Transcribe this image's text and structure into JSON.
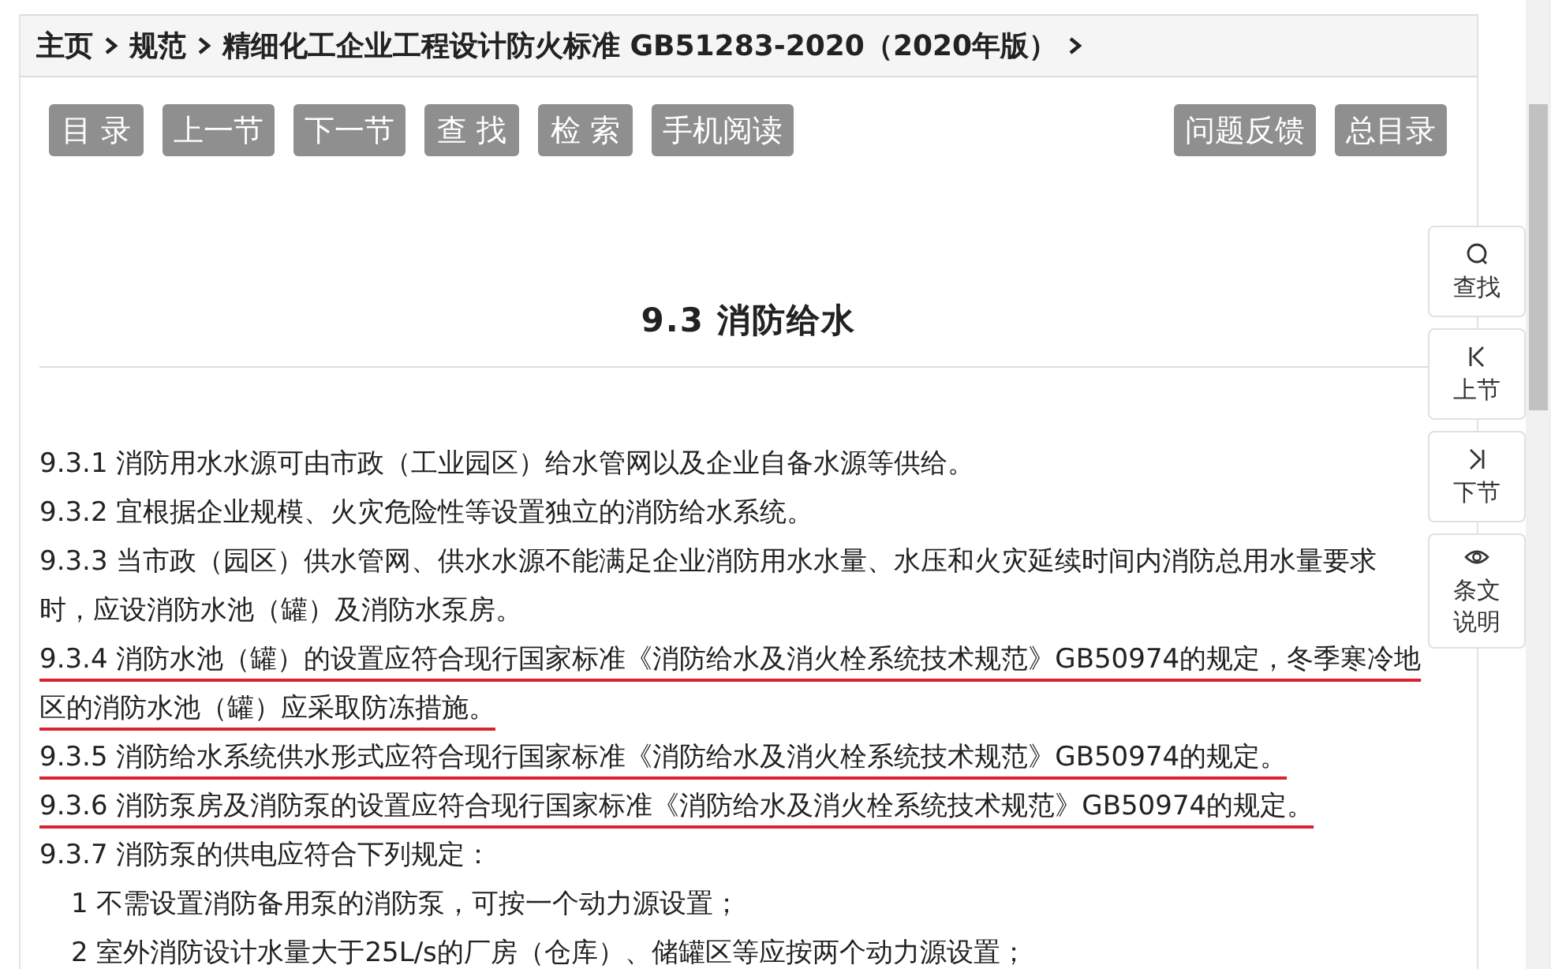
{
  "breadcrumb": [
    {
      "label": "主页"
    },
    {
      "label": "规范"
    },
    {
      "label": "精细化工企业工程设计防火标准 GB51283-2020（2020年版）"
    }
  ],
  "toolbar": {
    "left": [
      "目 录",
      "上一节",
      "下一节",
      "查 找",
      "检 索",
      "手机阅读"
    ],
    "right": [
      "问题反馈",
      "总目录"
    ]
  },
  "section_title": "9.3 消防给水",
  "paragraphs": [
    {
      "kind": "clause",
      "text": "9.3.1 消防用水水源可由市政（工业园区）给水管网以及企业自备水源等供给。",
      "underlined": false
    },
    {
      "kind": "clause",
      "text": "9.3.2 宜根据企业规模、火灾危险性等设置独立的消防给水系统。",
      "underlined": false
    },
    {
      "kind": "clause",
      "text": "9.3.3 当市政（园区）供水管网、供水水源不能满足企业消防用水水量、水压和火灾延续时间内消防总用水量要求时，应设消防水池（罐）及消防水泵房。",
      "underlined": false
    },
    {
      "kind": "clause",
      "text": "9.3.4 消防水池（罐）的设置应符合现行国家标准《消防给水及消火栓系统技术规范》GB50974的规定，冬季寒冷地区的消防水池（罐）应采取防冻措施。",
      "underlined": true
    },
    {
      "kind": "clause",
      "text": "9.3.5 消防给水系统供水形式应符合现行国家标准《消防给水及消火栓系统技术规范》GB50974的规定。",
      "underlined": true
    },
    {
      "kind": "clause",
      "text": "9.3.6 消防泵房及消防泵的设置应符合现行国家标准《消防给水及消火栓系统技术规范》GB50974的规定。",
      "underlined": true
    },
    {
      "kind": "clause",
      "text": "9.3.7 消防泵的供电应符合下列规定：",
      "underlined": false
    },
    {
      "kind": "item",
      "text": "1 不需设置消防备用泵的消防泵，可按一个动力源设置；",
      "underlined": false
    },
    {
      "kind": "item",
      "text": "2 室外消防设计水量大于25L/s的厂房（仓库）、储罐区等应按两个动力源设置；"
    }
  ],
  "side_tools": [
    {
      "kind": "search",
      "label": "查找"
    },
    {
      "kind": "prev",
      "label": "上节"
    },
    {
      "kind": "next",
      "label": "下节"
    },
    {
      "kind": "eye",
      "label": "条文说明"
    }
  ]
}
